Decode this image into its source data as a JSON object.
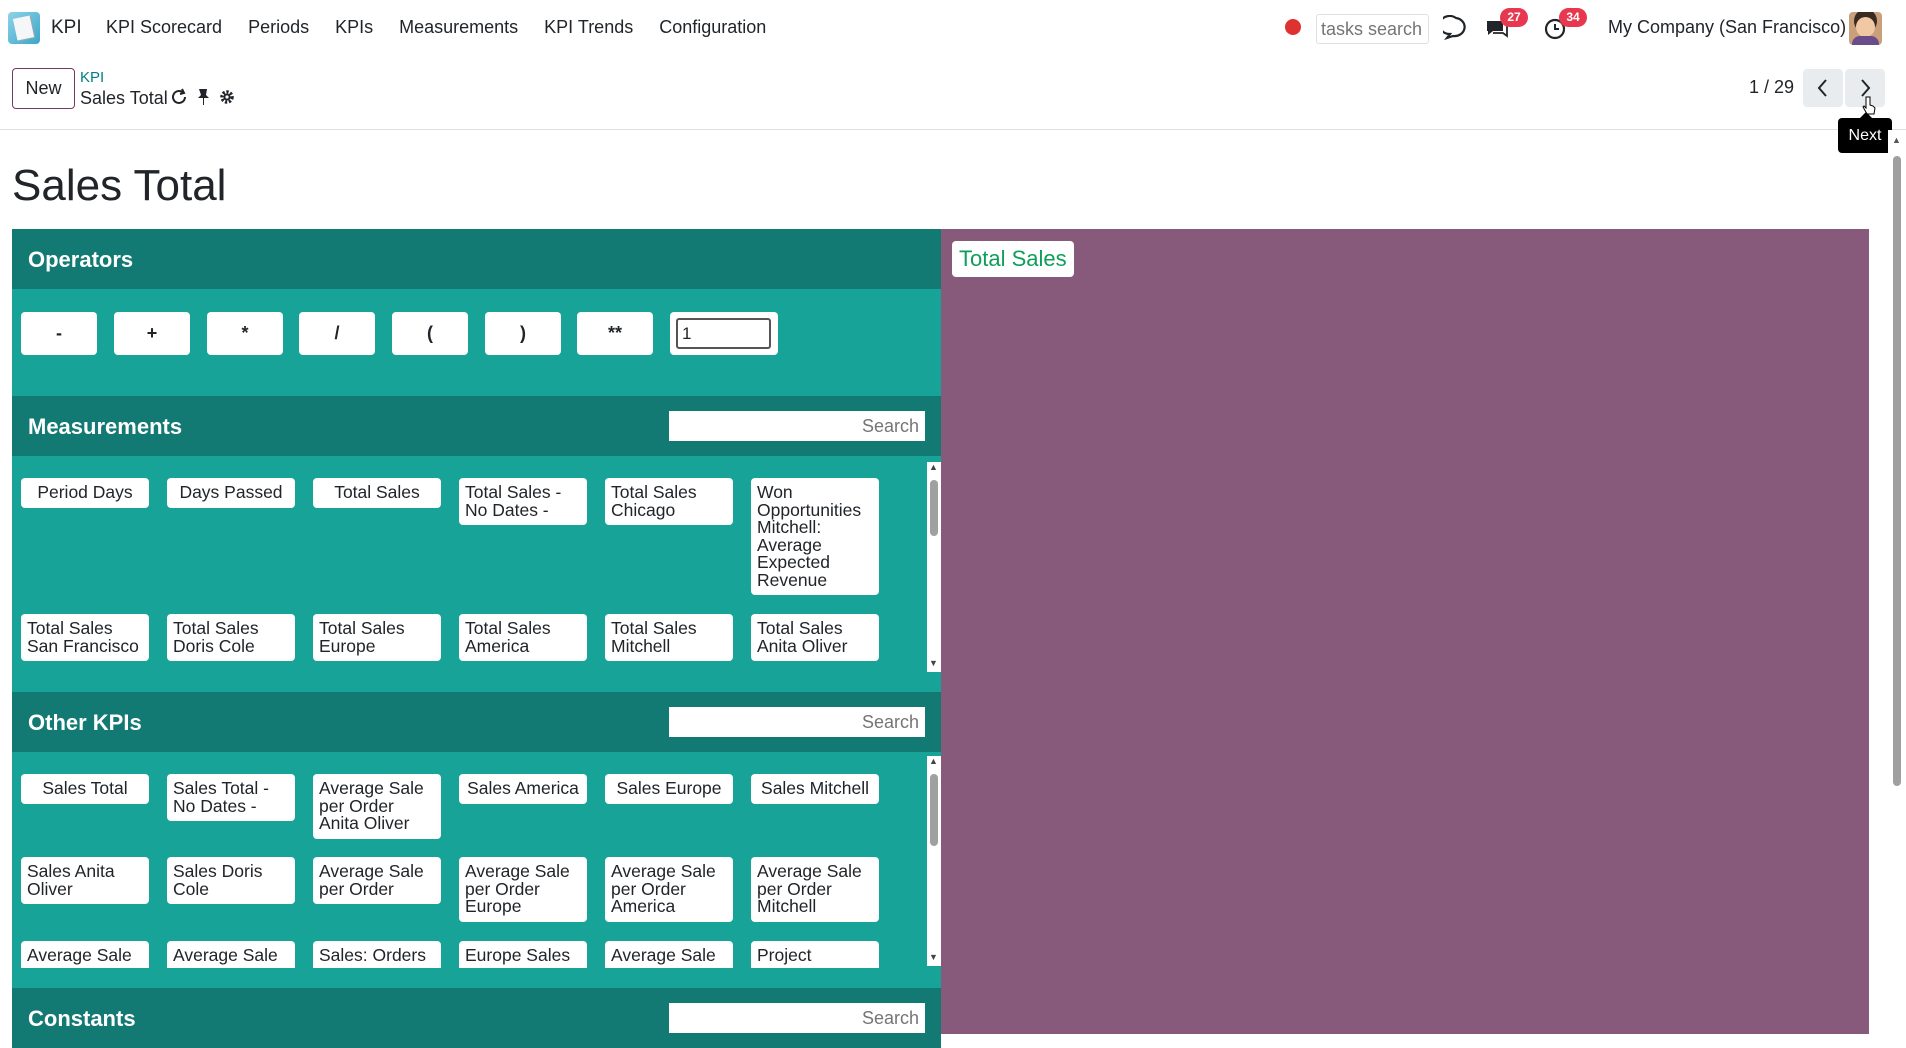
{
  "navbar": {
    "app_name": "KPI",
    "menu": [
      "KPI Scorecard",
      "Periods",
      "KPIs",
      "Measurements",
      "KPI Trends",
      "Configuration"
    ],
    "tasks_search_placeholder": "tasks search",
    "messages_count": "27",
    "activities_count": "34",
    "company": "My Company (San Francisco)",
    "icons": [
      "record-dot-icon",
      "chat-bubble-icon",
      "messages-icon",
      "activity-clock-icon"
    ]
  },
  "control": {
    "new_label": "New",
    "breadcrumb_parent": "KPI",
    "breadcrumb_current": "Sales Total",
    "pager_value": "1 / 29",
    "tooltip": "Next"
  },
  "page": {
    "title": "Sales Total"
  },
  "operators": {
    "title": "Operators",
    "buttons": [
      "-",
      "+",
      "*",
      "/",
      "(",
      ")",
      "**"
    ],
    "number_value": "1"
  },
  "measurements": {
    "title": "Measurements",
    "search_placeholder": "Search",
    "items": [
      [
        "Period Days",
        "Days Passed",
        "Total Sales",
        "Total Sales - No Dates -",
        "Total Sales Chicago",
        "Won Opportunities Mitchell: Average Expected Revenue"
      ],
      [
        "Total Sales San Francisco",
        "Total Sales Doris Cole",
        "Total Sales Europe",
        "Total Sales America",
        "Total Sales Mitchell",
        "Total Sales Anita Oliver"
      ]
    ]
  },
  "other_kpis": {
    "title": "Other KPIs",
    "search_placeholder": "Search",
    "items": [
      [
        "Sales Total",
        "Sales Total - No Dates -",
        "Average Sale per Order Anita Oliver",
        "Sales America",
        "Sales Europe",
        "Sales Mitchell"
      ],
      [
        "Sales Anita Oliver",
        "Sales Doris Cole",
        "Average Sale per Order",
        "Average Sale per Order Europe",
        "Average Sale per Order America",
        "Average Sale per Order Mitchell"
      ],
      [
        "Average Sale",
        "Average Sale",
        "Sales: Orders",
        "Europe Sales",
        "Average Sale",
        "Project"
      ]
    ]
  },
  "constants": {
    "title": "Constants",
    "search_placeholder": "Search"
  },
  "formula": {
    "tokens": [
      "Total Sales"
    ]
  },
  "colors": {
    "section_bg": "#17a398",
    "section_header": "#137a73",
    "formula_bg": "#875a7b",
    "formula_token": "#0f9e5a",
    "badge": "#e8384f",
    "primary": "#6f3a64",
    "link": "#017e84"
  }
}
